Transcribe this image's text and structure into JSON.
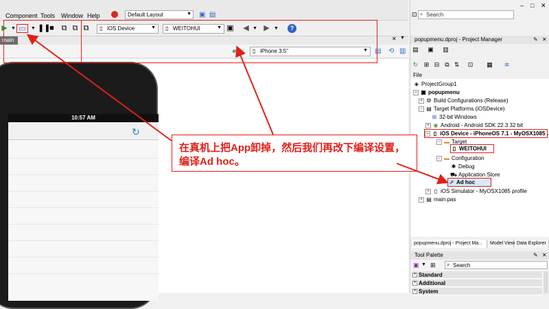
{
  "menu": {
    "items": [
      "Component",
      "Tools",
      "Window",
      "Help"
    ],
    "layout": "Default Layout"
  },
  "toolbar": {
    "device_combo": "iOS Device",
    "profile_combo": "WEITOHUI"
  },
  "designer": {
    "tab": "main",
    "views_label": "ews:",
    "views_combo": "iPhone 3.5\"",
    "time": "10:57 AM"
  },
  "search": {
    "placeholder": "Search"
  },
  "project_manager": {
    "title": "popupmenu.dproj - Project Manager",
    "file_header": "File",
    "tree": {
      "group": "ProjectGroup1",
      "project": "popupmenu",
      "build_configs": "Build Configurations (Release)",
      "target_platforms": "Target Platforms (iOSDevice)",
      "win32": "32-bit Windows",
      "android": "Android - Android SDK 22.3 32 bit",
      "ios_device": "iOS Device - iPhoneOS 7.1 - MyOSX1085 ...",
      "target": "Target",
      "weitohui": "WEITOHUI",
      "configuration": "Configuration",
      "debug": "Debug",
      "app_store": "Application Store",
      "adhoc": "Ad hoc",
      "simulator": "iOS Simulator - MyOSX1085 profile",
      "main_pas": "main.pas"
    }
  },
  "bottom_tabs": [
    "popupmenu.dproj - Project Ma...",
    "Model View",
    "Data Explorer"
  ],
  "tool_palette": {
    "title": "Tool Palette",
    "search_placeholder": "Search",
    "categories": [
      "Standard",
      "Additional",
      "System"
    ]
  },
  "annotation": {
    "line1": "在真机上把App卸掉，然后我们再改下编译设置，",
    "line2": "编译Ad hoc。"
  },
  "colors": {
    "annotation": "#e0201a",
    "accent": "#1a7fd6"
  },
  "icons": [
    "run-icon",
    "debug-icon",
    "pause-icon",
    "stop-icon",
    "back-icon",
    "forward-icon",
    "help-icon",
    "search-icon",
    "refresh-icon",
    "phone-icon"
  ]
}
